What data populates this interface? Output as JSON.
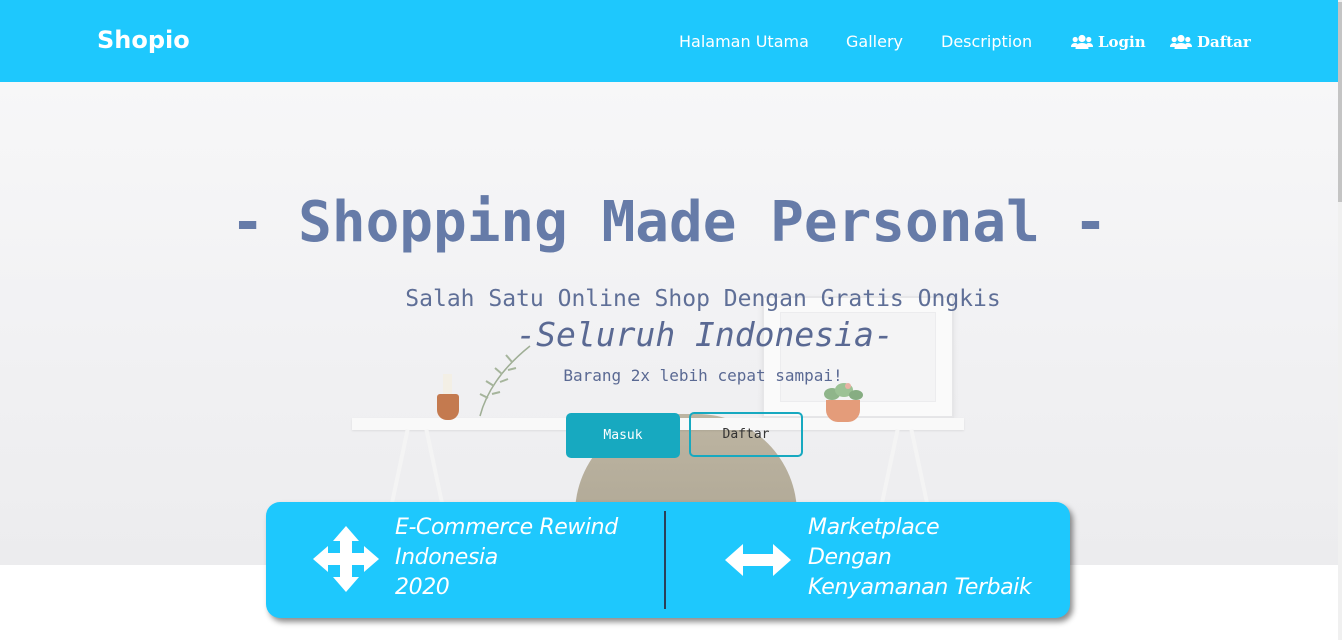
{
  "navbar": {
    "brand": "Shopio",
    "links": [
      "Halaman Utama",
      "Gallery",
      "Description"
    ],
    "login_label": "Login",
    "daftar_label": "Daftar"
  },
  "hero": {
    "title": "- Shopping Made Personal -",
    "subtitle": "Salah Satu Online Shop Dengan Gratis Ongkis",
    "subtitle2": "-Seluruh Indonesia-",
    "tagline": "Barang 2x lebih cepat sampai!",
    "masuk_button": "Masuk",
    "daftar_button": "Daftar"
  },
  "info_card": {
    "left_lines": [
      "E-Commerce Rewind",
      "Indonesia",
      "2020"
    ],
    "right_lines": [
      "Marketplace",
      "Dengan",
      "Kenyamanan Terbaik"
    ],
    "left_icon": "arrows-move-icon",
    "right_icon": "arrows-horizontal-icon"
  },
  "colors": {
    "accent": "#1ec8fd",
    "button_teal": "#17a9c0",
    "hero_text": "#667ba8"
  }
}
